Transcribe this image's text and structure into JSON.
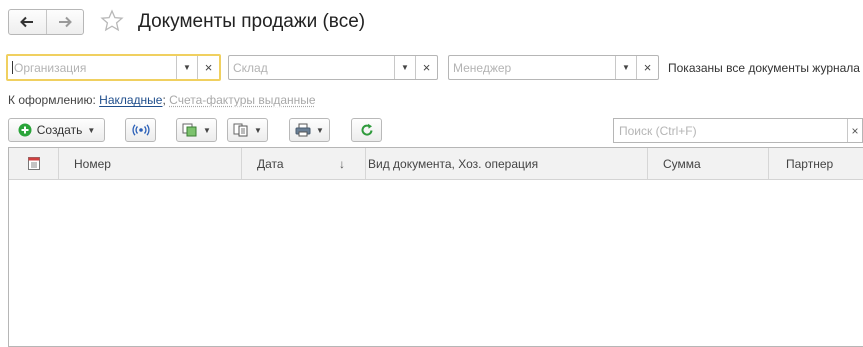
{
  "header": {
    "title": "Документы продажи (все)",
    "back_icon": "arrow-left-icon",
    "forward_icon": "arrow-right-icon",
    "favorite_icon": "star-icon"
  },
  "filters": {
    "organization_placeholder": "Организация",
    "warehouse_placeholder": "Склад",
    "manager_placeholder": "Менеджер",
    "info_text": "Показаны все документы журнала",
    "clear_glyph": "×",
    "dropdown_glyph": "▼"
  },
  "to_process": {
    "label": "К оформлению:",
    "link_invoices": "Накладные",
    "separator": ";",
    "link_tax_invoices": "Счета-фактуры выданные"
  },
  "toolbar": {
    "create_label": "Создать",
    "search_placeholder": "Поиск (Ctrl+F)",
    "search_clear": "×",
    "dropdown_glyph": "▼"
  },
  "table": {
    "columns": [
      "Номер",
      "Дата",
      "Вид документа, Хоз. операция",
      "Сумма",
      "Партнер"
    ],
    "sort_indicator": "↓",
    "rows": []
  },
  "colors": {
    "focus_border": "#f0d060",
    "link": "#1f4e8c",
    "create_icon": "#2aa43a",
    "refresh_icon": "#2e9a3b",
    "accent_blue": "#2b60b8"
  }
}
